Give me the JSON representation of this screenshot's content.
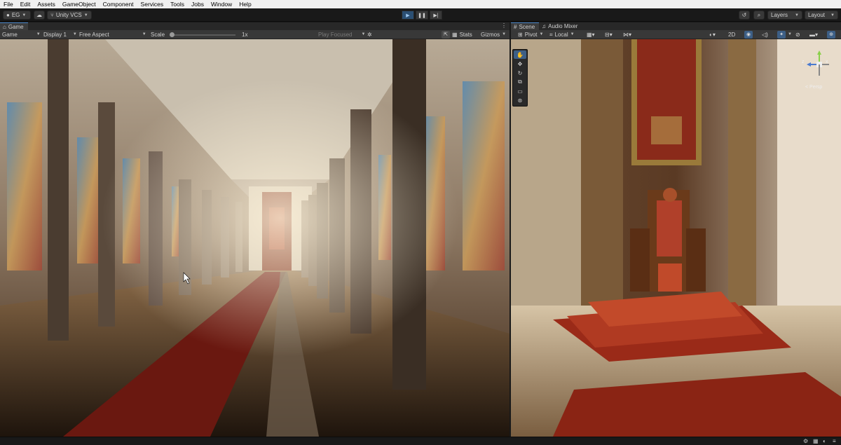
{
  "menu": [
    "File",
    "Edit",
    "Assets",
    "GameObject",
    "Component",
    "Services",
    "Tools",
    "Jobs",
    "Window",
    "Help"
  ],
  "toolbar": {
    "account_label": "EG",
    "vcs_label": "Unity VCS",
    "layers_label": "Layers",
    "layout_label": "Layout"
  },
  "game_panel": {
    "tab_label": "Game",
    "mode_label": "Game",
    "display_label": "Display 1",
    "aspect_label": "Free Aspect",
    "scale_label": "Scale",
    "scale_value": "1x",
    "scale_fraction": 0.0,
    "play_focused_label": "Play Focused",
    "stats_label": "Stats",
    "gizmos_label": "Gizmos"
  },
  "scene_panel": {
    "tab_scene_label": "Scene",
    "tab_audio_label": "Audio Mixer",
    "pivot_label": "Pivot",
    "local_label": "Local",
    "mode_2d_label": "2D",
    "persp_label": "< Persp",
    "gizmo_axis_z": "z",
    "gizmo_axis_x": "x"
  },
  "colors": {
    "accent": "#4a86c8",
    "play_active": "#2b4f73",
    "panel_bg": "#383838",
    "carpet": "#7a1a10"
  },
  "icons": {
    "play": "play-icon",
    "pause": "pause-icon",
    "step": "step-icon"
  }
}
